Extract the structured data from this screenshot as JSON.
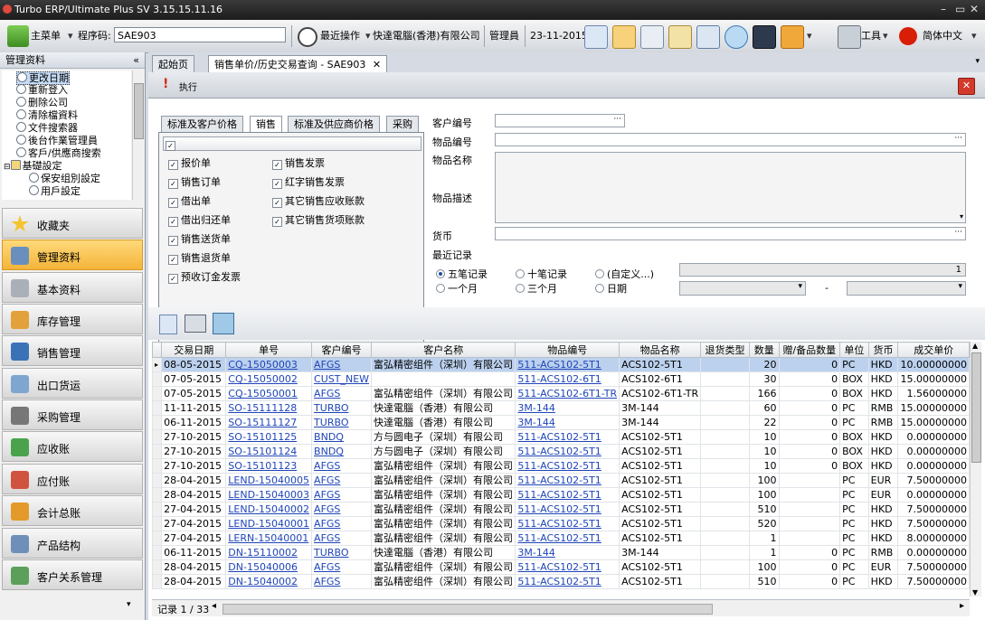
{
  "window": {
    "title": "Turbo ERP/Ultimate Plus SV 3.15.15.11.16"
  },
  "toolbar": {
    "main_menu": "主菜单",
    "program_code_label": "程序码:",
    "program_code_value": "SAE903",
    "recent_ops": "最近操作",
    "company": "快達電腦(香港)有限公司",
    "user": "管理員",
    "date": "23-11-2015",
    "tools": "工具",
    "language": "简体中文"
  },
  "left_panel": {
    "header": "管理资料",
    "tree": [
      "更改日期",
      "重新登入",
      "删除公司",
      "清除檔資料",
      "文件搜索器",
      "後台作業管理員",
      "客戶/供應商搜索",
      "基礎設定",
      "保安组別設定",
      "用戶設定"
    ],
    "nav": [
      "收藏夹",
      "管理资料",
      "基本资料",
      "库存管理",
      "销售管理",
      "出口货运",
      "采购管理",
      "应收账",
      "应付账",
      "会计总账",
      "产品结构",
      "客户关系管理"
    ]
  },
  "tabs": {
    "home": "起始页",
    "current": "销售单价/历史交易查询 - SAE903"
  },
  "exec": {
    "label": "执行"
  },
  "filters": {
    "subtabs": [
      "标准及客户价格",
      "销售",
      "标准及供应商价格",
      "采购"
    ],
    "sales_checks_left": [
      "报价单",
      "销售订单",
      "借出单",
      "借出归还单",
      "销售送货单",
      "销售退货单",
      "预收订金发票"
    ],
    "sales_checks_right": [
      "销售发票",
      "红字销售发票",
      "其它销售应收账款",
      "其它销售货项账款"
    ],
    "customer_no": "客户编号",
    "item_no": "物品编号",
    "item_name": "物品名称",
    "item_desc": "物品描述",
    "currency": "货币",
    "recent_records": "最近记录",
    "radio": [
      "五笔记录",
      "十笔记录",
      "(自定义...)",
      "一个月",
      "三个月",
      "日期"
    ],
    "custom_count": "1",
    "dash": "-"
  },
  "grid": {
    "columns": [
      "交易日期",
      "单号",
      "客户编号",
      "客户名称",
      "物品编号",
      "物品名称",
      "退货类型",
      "数量",
      "赠/备品数量",
      "单位",
      "货币",
      "成交单价"
    ],
    "rows": [
      [
        "08-05-2015",
        "CQ-15050003",
        "AFGS",
        "富弘精密组件（深圳）有限公司",
        "511-ACS102-5T1",
        "ACS102-5T1",
        "",
        "20",
        "0",
        "PC",
        "HKD",
        "10.00000000"
      ],
      [
        "07-05-2015",
        "CQ-15050002",
        "CUST_NEW",
        "",
        "511-ACS102-6T1",
        "ACS102-6T1",
        "",
        "30",
        "0",
        "BOX",
        "HKD",
        "15.00000000"
      ],
      [
        "07-05-2015",
        "CQ-15050001",
        "AFGS",
        "富弘精密组件（深圳）有限公司",
        "511-ACS102-6T1-TR",
        "ACS102-6T1-TR",
        "",
        "166",
        "0",
        "BOX",
        "HKD",
        "1.56000000"
      ],
      [
        "11-11-2015",
        "SO-15111128",
        "TURBO",
        "快達電腦（香港）有限公司",
        "3M-144",
        "3M-144",
        "",
        "60",
        "0",
        "PC",
        "RMB",
        "15.00000000"
      ],
      [
        "06-11-2015",
        "SO-15111127",
        "TURBO",
        "快達電腦（香港）有限公司",
        "3M-144",
        "3M-144",
        "",
        "22",
        "0",
        "PC",
        "RMB",
        "15.00000000"
      ],
      [
        "27-10-2015",
        "SO-15101125",
        "BNDQ",
        "方与圆电子（深圳）有限公司",
        "511-ACS102-5T1",
        "ACS102-5T1",
        "",
        "10",
        "0",
        "BOX",
        "HKD",
        "0.00000000"
      ],
      [
        "27-10-2015",
        "SO-15101124",
        "BNDQ",
        "方与圆电子（深圳）有限公司",
        "511-ACS102-5T1",
        "ACS102-5T1",
        "",
        "10",
        "0",
        "BOX",
        "HKD",
        "0.00000000"
      ],
      [
        "27-10-2015",
        "SO-15101123",
        "AFGS",
        "富弘精密组件（深圳）有限公司",
        "511-ACS102-5T1",
        "ACS102-5T1",
        "",
        "10",
        "0",
        "BOX",
        "HKD",
        "0.00000000"
      ],
      [
        "28-04-2015",
        "LEND-15040005",
        "AFGS",
        "富弘精密组件（深圳）有限公司",
        "511-ACS102-5T1",
        "ACS102-5T1",
        "",
        "100",
        "",
        "PC",
        "EUR",
        "7.50000000"
      ],
      [
        "28-04-2015",
        "LEND-15040003",
        "AFGS",
        "富弘精密组件（深圳）有限公司",
        "511-ACS102-5T1",
        "ACS102-5T1",
        "",
        "100",
        "",
        "PC",
        "EUR",
        "0.00000000"
      ],
      [
        "27-04-2015",
        "LEND-15040002",
        "AFGS",
        "富弘精密组件（深圳）有限公司",
        "511-ACS102-5T1",
        "ACS102-5T1",
        "",
        "510",
        "",
        "PC",
        "HKD",
        "7.50000000"
      ],
      [
        "27-04-2015",
        "LEND-15040001",
        "AFGS",
        "富弘精密组件（深圳）有限公司",
        "511-ACS102-5T1",
        "ACS102-5T1",
        "",
        "520",
        "",
        "PC",
        "HKD",
        "7.50000000"
      ],
      [
        "27-04-2015",
        "LERN-15040001",
        "AFGS",
        "富弘精密组件（深圳）有限公司",
        "511-ACS102-5T1",
        "ACS102-5T1",
        "",
        "1",
        "",
        "PC",
        "HKD",
        "8.00000000"
      ],
      [
        "06-11-2015",
        "DN-15110002",
        "TURBO",
        "快達電腦（香港）有限公司",
        "3M-144",
        "3M-144",
        "",
        "1",
        "0",
        "PC",
        "RMB",
        "0.00000000"
      ],
      [
        "28-04-2015",
        "DN-15040006",
        "AFGS",
        "富弘精密组件（深圳）有限公司",
        "511-ACS102-5T1",
        "ACS102-5T1",
        "",
        "100",
        "0",
        "PC",
        "EUR",
        "7.50000000"
      ],
      [
        "28-04-2015",
        "DN-15040002",
        "AFGS",
        "富弘精密组件（深圳）有限公司",
        "511-ACS102-5T1",
        "ACS102-5T1",
        "",
        "510",
        "0",
        "PC",
        "HKD",
        "7.50000000"
      ]
    ]
  },
  "status": {
    "record": "记录 1 / 33"
  }
}
